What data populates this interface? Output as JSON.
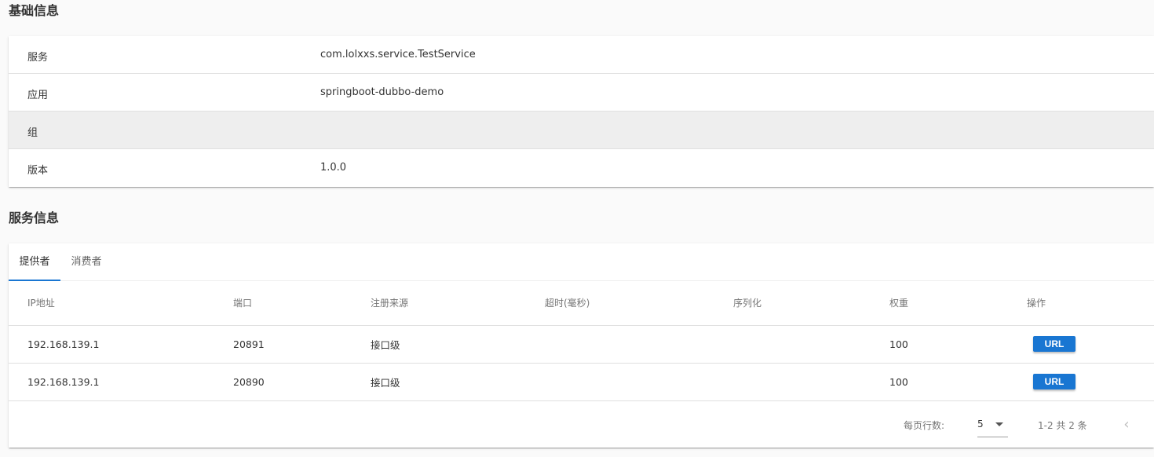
{
  "sections": {
    "basic_title": "基础信息",
    "service_title": "服务信息"
  },
  "basic_info": [
    {
      "label": "服务",
      "value": "com.lolxxs.service.TestService"
    },
    {
      "label": "应用",
      "value": "springboot-dubbo-demo"
    },
    {
      "label": "组",
      "value": ""
    },
    {
      "label": "版本",
      "value": "1.0.0"
    }
  ],
  "tabs": [
    {
      "label": "提供者",
      "active": true
    },
    {
      "label": "消费者",
      "active": false
    }
  ],
  "table": {
    "headers": [
      "IP地址",
      "端口",
      "注册来源",
      "超时(毫秒)",
      "序列化",
      "权重",
      "操作"
    ],
    "rows": [
      {
        "ip": "192.168.139.1",
        "port": "20891",
        "source": "接口级",
        "timeout": "",
        "serialization": "",
        "weight": "100",
        "action": "URL"
      },
      {
        "ip": "192.168.139.1",
        "port": "20890",
        "source": "接口级",
        "timeout": "",
        "serialization": "",
        "weight": "100",
        "action": "URL"
      }
    ]
  },
  "footer": {
    "rows_per_page_label": "每页行数:",
    "rows_per_page_value": "5",
    "page_range": "1-2 共 2 条",
    "prev_icon": "chevron-left-icon"
  },
  "colors": {
    "accent": "#1976d2",
    "background": "#fafafa",
    "card": "#ffffff",
    "hover_row": "#eeeeee"
  }
}
